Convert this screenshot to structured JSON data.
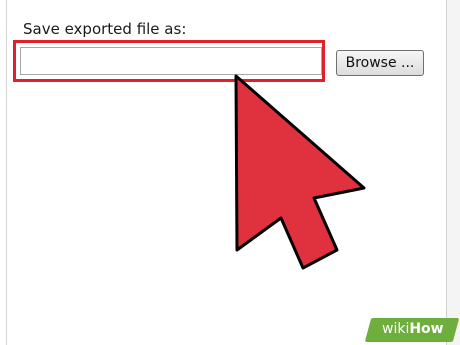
{
  "export_dialog": {
    "label": "Save exported file as:",
    "path_value": "",
    "browse_label": "Browse ..."
  },
  "annotation": {
    "highlight_color": "#e0202a",
    "cursor_color": "#e0323e",
    "cursor_icon": "mouse-pointer-arrow-icon"
  },
  "watermark": {
    "brand_part1": "wiki",
    "brand_part2": "How",
    "color": "#6dae3c"
  }
}
